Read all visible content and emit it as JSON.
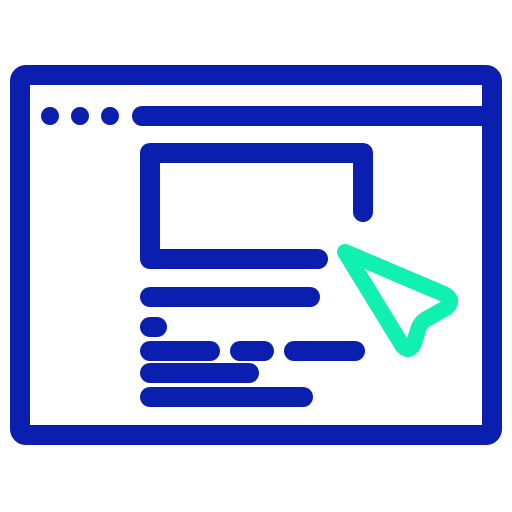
{
  "icon": {
    "name": "web-page-click-icon",
    "colors": {
      "frame": "#0a1fb0",
      "cursor": "#10f0b0",
      "background": "#ffffff"
    },
    "parts": [
      "browser-window-icon",
      "window-control-dots",
      "address-bar",
      "image-placeholder-icon",
      "text-lines",
      "cursor-arrow-icon"
    ]
  }
}
